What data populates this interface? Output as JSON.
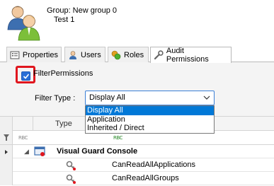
{
  "header": {
    "group_label": "Group: New group 0",
    "group_sub": "Test 1",
    "icon": "users-group-icon"
  },
  "tabs": [
    {
      "label": "Properties",
      "icon": "properties-icon",
      "active": false
    },
    {
      "label": "Users",
      "icon": "user-icon",
      "active": false
    },
    {
      "label": "Roles",
      "icon": "roles-icon",
      "active": false
    },
    {
      "label": "Audit Permissions",
      "icon": "wrench-icon",
      "active": true
    }
  ],
  "filter": {
    "checkbox_label": "FilterPermissions",
    "checked": true,
    "type_label": "Filter Type :",
    "selected": "Display All",
    "options": [
      "Display All",
      "Application",
      "Inherited / Direct"
    ]
  },
  "grid": {
    "columns": [
      "Type"
    ],
    "filter_placeholder": "RBC",
    "group": {
      "title": "Visual Guard Console",
      "expand_glyph": "◢"
    },
    "items": [
      "CanReadAllApplications",
      "CanReadAllGroups"
    ]
  },
  "colors": {
    "highlight": "#e0161e",
    "accent": "#0078d7",
    "checkbox": "#2a6fd6"
  }
}
